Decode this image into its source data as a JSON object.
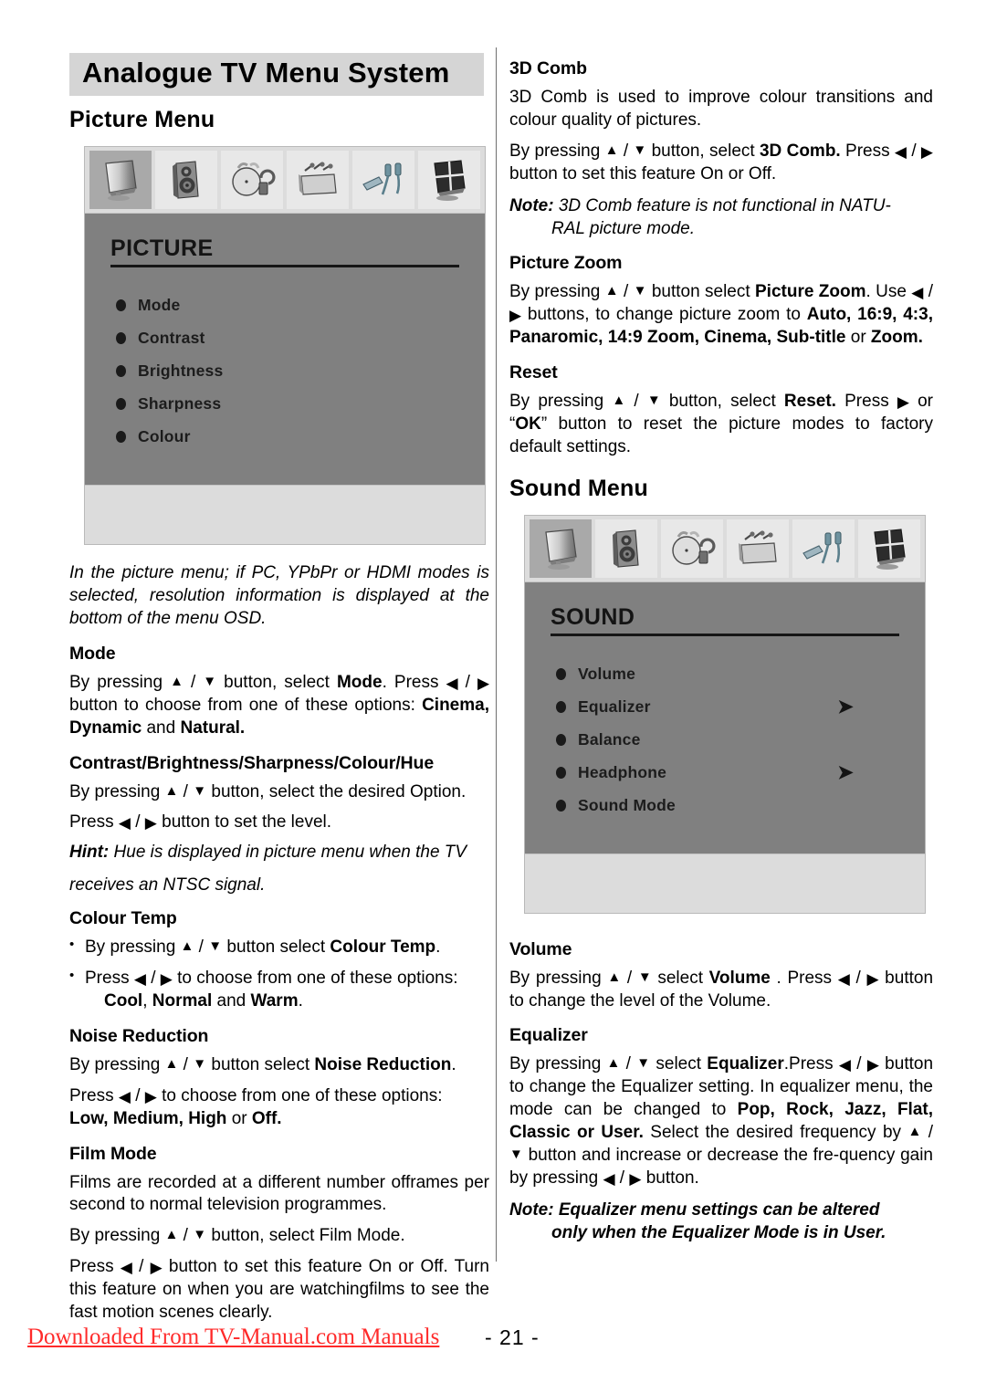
{
  "header": {
    "title": "Analogue TV Menu System"
  },
  "left": {
    "section_title": "Picture Menu",
    "osd": {
      "title": "PICTURE",
      "icons": [
        "tv-monitor-icon",
        "speaker-icon",
        "clock-lock-icon",
        "toolbox-icon",
        "cables-icon",
        "tiled-screen-icon"
      ],
      "selected_icon_index": 0,
      "items": [
        {
          "label": "Mode",
          "arrow": ""
        },
        {
          "label": "Contrast",
          "arrow": ""
        },
        {
          "label": "Brightness",
          "arrow": ""
        },
        {
          "label": "Sharpness",
          "arrow": ""
        },
        {
          "label": "Colour",
          "arrow": ""
        }
      ]
    },
    "intro_italic": "In the picture menu; if PC, YPbPr or HDMI modes is selected, resolution information is displayed at the bottom of the menu OSD.",
    "mode": {
      "heading": "Mode",
      "p1_a": "By pressing ",
      "p1_b": " / ",
      "p1_c": " button, select ",
      "p1_bold1": "Mode",
      "p1_d": ". Press ",
      "p1_e": " / ",
      "p1_f": " button to choose from one of these options: ",
      "p1_bold2": "Cinema,",
      "p1_bold3": "Dynamic",
      "p1_g": " and ",
      "p1_bold4": "Natural."
    },
    "cbsch": {
      "heading": "Contrast/Brightness/Sharpness/Colour/Hue",
      "p1_a": "By pressing ",
      "p1_b": " / ",
      "p1_c": " button, select the desired Option.",
      "p2_a": "Press ",
      "p2_b": " / ",
      "p2_c": " button to set the level.",
      "hint_label": "Hint:",
      "hint_text": " Hue is displayed in picture menu when the TV",
      "hint_text2": "receives an NTSC signal."
    },
    "colour_temp": {
      "heading": "Colour Temp",
      "b1_a": "By pressing ",
      "b1_b": " / ",
      "b1_c": " button select ",
      "b1_bold": "Colour Temp",
      "b1_d": ".",
      "b2_a": "Press ",
      "b2_b": " / ",
      "b2_c": " to choose from one of these options:",
      "b2_bold1": "Cool",
      "b2_sep1": ", ",
      "b2_bold2": "Normal",
      "b2_sep2": " and ",
      "b2_bold3": "Warm",
      "b2_end": "."
    },
    "noise_reduction": {
      "heading": "Noise Reduction",
      "p1_a": "By pressing ",
      "p1_b": " / ",
      "p1_c": " button select ",
      "p1_bold": "Noise Reduction",
      "p1_d": ".",
      "p2_a": "Press ",
      "p2_b": " / ",
      "p2_c": " to choose from one of these options:",
      "p2_bold1": "Low,",
      "p2_bold2": "Medium,",
      "p2_bold3": "High",
      "p2_mid": " or ",
      "p2_bold4": "Off."
    },
    "film_mode": {
      "heading": "Film Mode",
      "p1": "Films are recorded at a different number offrames per second to normal television programmes.",
      "p2_a": "By pressing ",
      "p2_b": " / ",
      "p2_c": " button, select Film Mode.",
      "p3_a": "Press ",
      "p3_b": " / ",
      "p3_c": " button to set this feature On or Off. Turn this feature on when you are watchingfilms to see the fast motion scenes clearly."
    }
  },
  "right": {
    "comb3d": {
      "heading": "3D Comb",
      "p1": "3D Comb is used to improve colour transitions and colour quality of  pictures.",
      "p2_a": "By pressing ",
      "p2_b": " / ",
      "p2_c": " button, select ",
      "p2_bold": "3D Comb.",
      "p2_d": " Press ",
      "p2_e": " / ",
      "p2_f": " button to set this feature On or Off.",
      "note_label": "Note:",
      "note_text": " 3D Comb feature is not functional in NATU-",
      "note_text2": "RAL picture mode."
    },
    "picture_zoom": {
      "heading": "Picture Zoom",
      "p1_a": "By pressing ",
      "p1_b": " / ",
      "p1_c": " button  select ",
      "p1_bold": "Picture Zoom",
      "p1_d": ". Use ",
      "p1_e": " / ",
      "p1_f": " buttons, to change picture zoom  to ",
      "p1_bold2": "Auto, 16:9, 4:3, Panaromic, 14:9 Zoom, Cinema, Sub-title",
      "p1_g": " or ",
      "p1_bold3": "Zoom."
    },
    "reset": {
      "heading": "Reset",
      "p1_a": "By pressing ",
      "p1_b": " / ",
      "p1_c": " button, select ",
      "p1_bold": "Reset.",
      "p1_d": " Press ",
      "p1_e": " or “",
      "p1_bold2": "OK",
      "p1_f": "” button to reset the picture modes to factory default settings."
    },
    "section_title": "Sound Menu",
    "osd": {
      "title": "SOUND",
      "icons": [
        "tv-monitor-icon",
        "speaker-icon",
        "clock-lock-icon",
        "toolbox-icon",
        "cables-icon",
        "tiled-screen-icon"
      ],
      "selected_icon_index": 0,
      "items": [
        {
          "label": "Volume",
          "arrow": ""
        },
        {
          "label": "Equalizer",
          "arrow": "➤"
        },
        {
          "label": "Balance",
          "arrow": ""
        },
        {
          "label": "Headphone",
          "arrow": "➤"
        },
        {
          "label": "Sound Mode",
          "arrow": ""
        }
      ]
    },
    "volume": {
      "heading": "Volume",
      "p1_a": "By pressing ",
      "p1_b": " / ",
      "p1_c": " select ",
      "p1_bold": "Volume",
      "p1_d": " . Press ",
      "p1_e": " / ",
      "p1_f": " button to change the level of the Volume."
    },
    "equalizer": {
      "heading": "Equalizer",
      "p1_a": "By pressing ",
      "p1_b": " / ",
      "p1_c": " select ",
      "p1_bold": "Equalizer",
      "p1_d": ".Press ",
      "p1_e": " / ",
      "p1_f": " button  to change the Equalizer setting. In equalizer menu, the mode can be changed to ",
      "p1_bold2": "Pop, Rock, Jazz, Flat, Classic or User.",
      "p1_g": " Select the desired frequency by ",
      "p1_h": " / ",
      "p1_i": " button and increase or decrease the fre-quency gain by pressing ",
      "p1_j": " / ",
      "p1_k": " button.",
      "note_label": "Note:",
      "note_text": " Equalizer menu settings can be altered",
      "note_text2": "only when the Equalizer Mode is in User."
    }
  },
  "footer": {
    "link_text": "Downloaded From TV-Manual.com Manuals",
    "page_number": "- 21 -",
    "link_color": "#ff2a2a"
  }
}
